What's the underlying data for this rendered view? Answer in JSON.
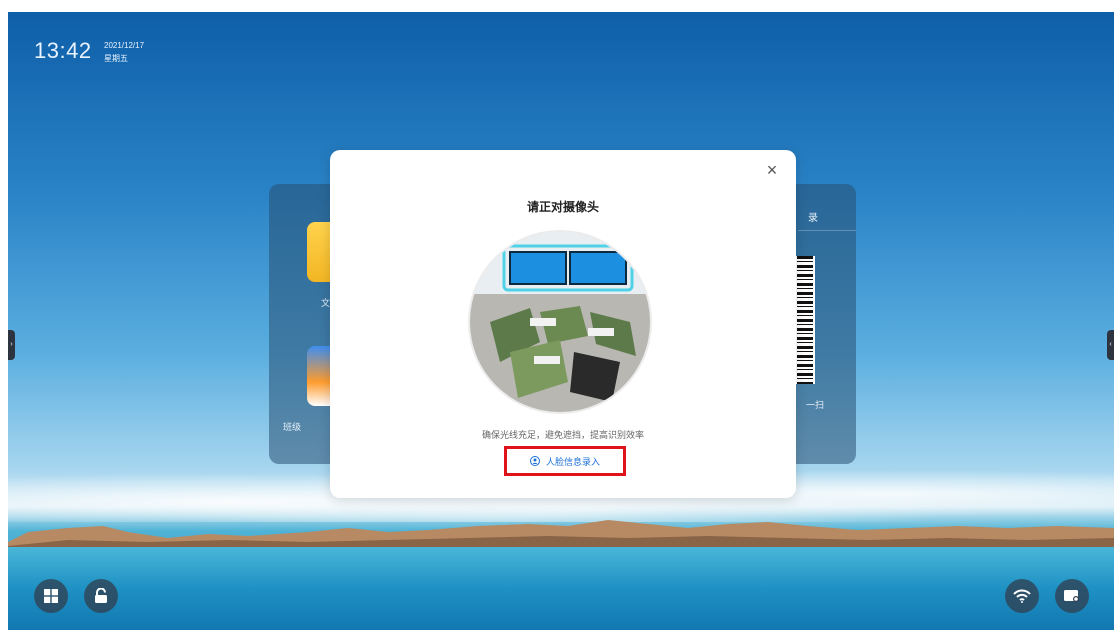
{
  "clock": {
    "time": "13:42",
    "date": "2021/12/17",
    "weekday": "星期五"
  },
  "background_panels": {
    "left": {
      "apps": [
        {
          "label": "文",
          "icon": "folder-app-icon"
        },
        {
          "label": "班级",
          "icon": "class-app-icon"
        }
      ]
    },
    "right": {
      "header_fragment": "录",
      "scan_fragment": "一扫",
      "icon": "qr-code-icon"
    }
  },
  "modal": {
    "title": "请正对摄像头",
    "hint": "确保光线充足，避免遮挡，提高识别效率",
    "enroll_button": {
      "label": "人脸信息录入",
      "icon": "face-user-icon",
      "color": "#1a6fd6",
      "highlight_color": "#e0121a"
    },
    "close_glyph": "×"
  },
  "edge_handles": {
    "left_glyph": "›",
    "right_glyph": "‹"
  },
  "taskbar": {
    "left_buttons": [
      {
        "name": "windows",
        "icon": "windows-icon"
      },
      {
        "name": "lock",
        "icon": "unlock-icon"
      }
    ],
    "right_buttons": [
      {
        "name": "wifi",
        "icon": "wifi-icon"
      },
      {
        "name": "settings",
        "icon": "device-settings-icon"
      }
    ]
  }
}
